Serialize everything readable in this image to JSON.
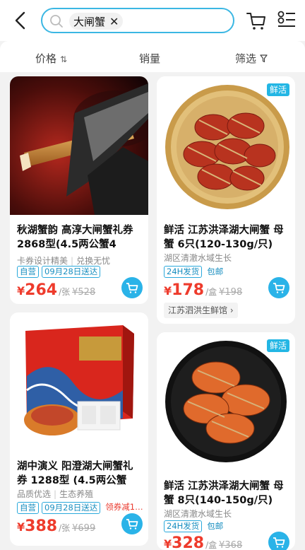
{
  "search": {
    "query": "大闸蟹",
    "clear_symbol": "✕"
  },
  "sort": {
    "price": "价格",
    "price_arrows": "⇅",
    "sales": "销量",
    "filter": "筛选"
  },
  "products": [
    {
      "title": "秋湖蟹韵 高淳大闸蟹礼券 2868型(4.5两公蟹4只,3…",
      "subtitle_a": "卡券设计精美",
      "subtitle_b": "兑换无忧",
      "tag_self": "自营",
      "tag_delivery": "09月28日送达",
      "price": "264",
      "unit": "/张",
      "old_price": "¥528",
      "image": "knife-and-crab-leg"
    },
    {
      "badge": "鲜活",
      "title": "鲜活 江苏洪泽湖大闸蟹 母蟹 6只(120-130g/只)",
      "subtitle_a": "湖区清澈水域生长",
      "tag_24h": "24H发货",
      "tag_free": "包邮",
      "price": "178",
      "unit": "/盒",
      "old_price": "¥198",
      "store": "江苏泗洪生鲜馆 ›",
      "image": "crabs-in-steamer"
    },
    {
      "title": "湖中演义 阳澄湖大闸蟹礼券 1288型 (4.5两公蟹4…",
      "subtitle_a": "品质优选",
      "subtitle_b": "生态养殖",
      "tag_self": "自营",
      "tag_delivery": "09月28日送达",
      "tag_coupon": "领券减1…",
      "price": "388",
      "unit": "/张",
      "old_price": "¥699",
      "image": "red-gift-box"
    },
    {
      "badge": "鲜活",
      "title": "鲜活 江苏洪泽湖大闸蟹 母蟹 8只(140-150g/只)",
      "subtitle_a": "湖区清澈水域生长",
      "tag_24h": "24H发货",
      "tag_free": "包邮",
      "price": "328",
      "unit": "/盒",
      "old_price": "¥368",
      "image": "crabs-on-black-plate"
    }
  ],
  "currency": "¥",
  "icons": [
    "back-arrow-icon",
    "search-icon",
    "cart-icon",
    "list-menu-icon",
    "filter-icon",
    "add-to-cart-icon"
  ],
  "colors": {
    "accent": "#2ab3e8",
    "price": "#ee3b2c"
  }
}
